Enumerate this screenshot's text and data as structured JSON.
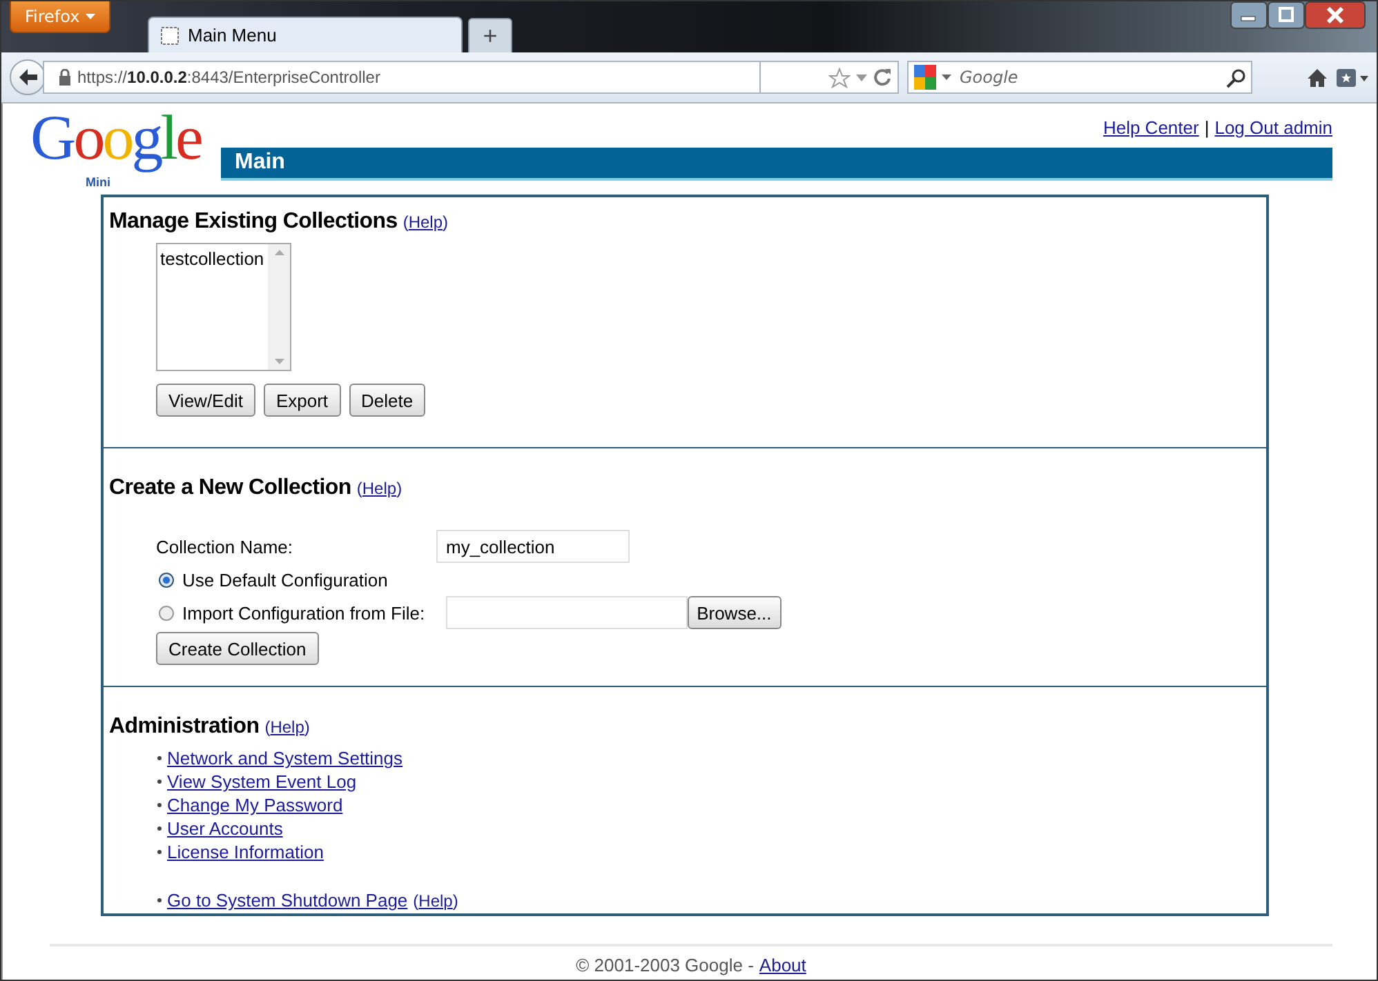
{
  "browser": {
    "menu_button": "Firefox",
    "tabs": [
      {
        "title": "Main Menu",
        "selected": true
      }
    ],
    "new_tab": "+",
    "url": "https://**10.0.0.2**:8443/EnterpriseController",
    "search": {
      "placeholder": "Google"
    }
  },
  "header": {
    "logo": "Google",
    "logo_sub": "Mini",
    "title": "Main",
    "links": [
      "Help Center",
      "Log Out admin"
    ],
    "separator": "|"
  },
  "manage": {
    "heading": "Manage Existing Collections",
    "help": {
      "before": "(",
      "link": "Help",
      "after": ")"
    },
    "collections": [
      {
        "name": "testcollection",
        "selected": false
      }
    ],
    "buttons": [
      "View/Edit",
      "Export",
      "Delete"
    ]
  },
  "create": {
    "heading": "Create a New Collection",
    "help": {
      "before": "(",
      "link": "Help",
      "after": ")"
    },
    "name_label": "Collection Name:",
    "name_value": "my_collection",
    "options": [
      {
        "label": "Use Default Configuration",
        "selected": true,
        "kind": "plain"
      },
      {
        "label": "Import Configuration from File:",
        "selected": false,
        "kind": "file"
      }
    ],
    "browse": "Browse...",
    "submit": "Create Collection"
  },
  "admin": {
    "heading": "Administration",
    "help": {
      "before": "(",
      "link": "Help",
      "after": ")"
    },
    "links": [
      "Network and System Settings",
      "View System Event Log",
      "Change My Password",
      "User Accounts",
      "License Information"
    ],
    "shutdown": {
      "link": "Go to System Shutdown Page",
      "help": {
        "before": "(",
        "link": "Help",
        "after": ")"
      }
    }
  },
  "footer": {
    "text": "© 2001-2003 Google -",
    "link": "About"
  }
}
